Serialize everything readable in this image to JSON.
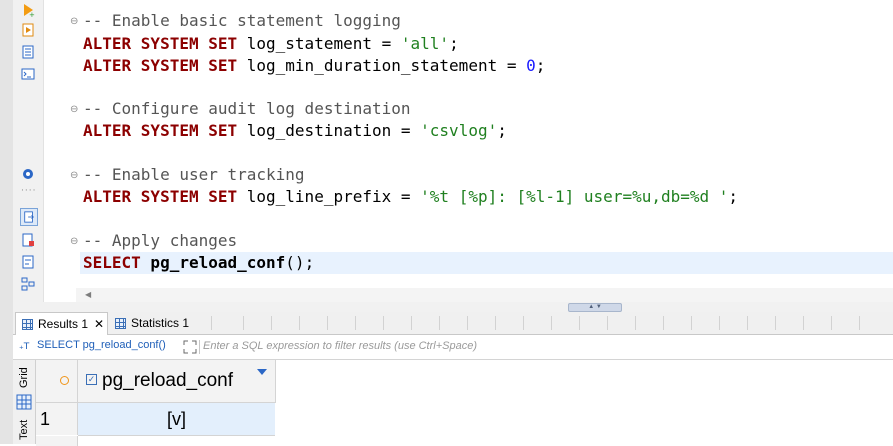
{
  "editor": {
    "lines": [
      {
        "comment": "-- Enable basic statement logging"
      },
      {
        "kw": "ALTER SYSTEM SET",
        "rest": " log_statement = ",
        "str": "'all'",
        "end": ";"
      },
      {
        "kw": "ALTER SYSTEM SET",
        "rest": " log_min_duration_statement = ",
        "num": "0",
        "end": ";"
      },
      {
        "comment": "-- Configure audit log destination"
      },
      {
        "kw": "ALTER SYSTEM SET",
        "rest": " log_destination = ",
        "str": "'csvlog'",
        "end": ";"
      },
      {
        "comment": "-- Enable user tracking"
      },
      {
        "kw": "ALTER SYSTEM SET",
        "rest": " log_line_prefix = ",
        "str": "'%t [%p]: [%l-1] user=%u,db=%d '",
        "end": ";"
      },
      {
        "comment": "-- Apply changes"
      },
      {
        "kw": "SELECT",
        "rest_bold": " pg_reload_conf",
        "end": "();"
      }
    ],
    "fold_glyph": "⊖",
    "toolbar_icons": [
      "execute-statement-icon",
      "execute-script-icon",
      "explain-plan-icon",
      "terminal-icon",
      "settings-icon",
      "export-icon",
      "new-script-icon",
      "format-icon",
      "outline-icon"
    ]
  },
  "results": {
    "tabs": [
      {
        "label": "Results 1",
        "close": "✕"
      },
      {
        "label": "Statistics 1"
      }
    ],
    "filter": {
      "query_label": "SELECT pg_reload_conf()",
      "placeholder": "Enter a SQL expression to filter results (use Ctrl+Space)"
    },
    "side_tabs": [
      "Grid",
      "Text"
    ],
    "columns": [
      "pg_reload_conf"
    ],
    "rows": [
      {
        "num": "1",
        "values": [
          "[v]"
        ]
      }
    ]
  },
  "colors": {
    "keyword": "#8c0000",
    "comment": "#555555",
    "string": "#208020",
    "number": "#1a1aff",
    "accent": "#2b67c6",
    "selected_row": "#e3effc",
    "current_line": "#e8f2fe"
  }
}
